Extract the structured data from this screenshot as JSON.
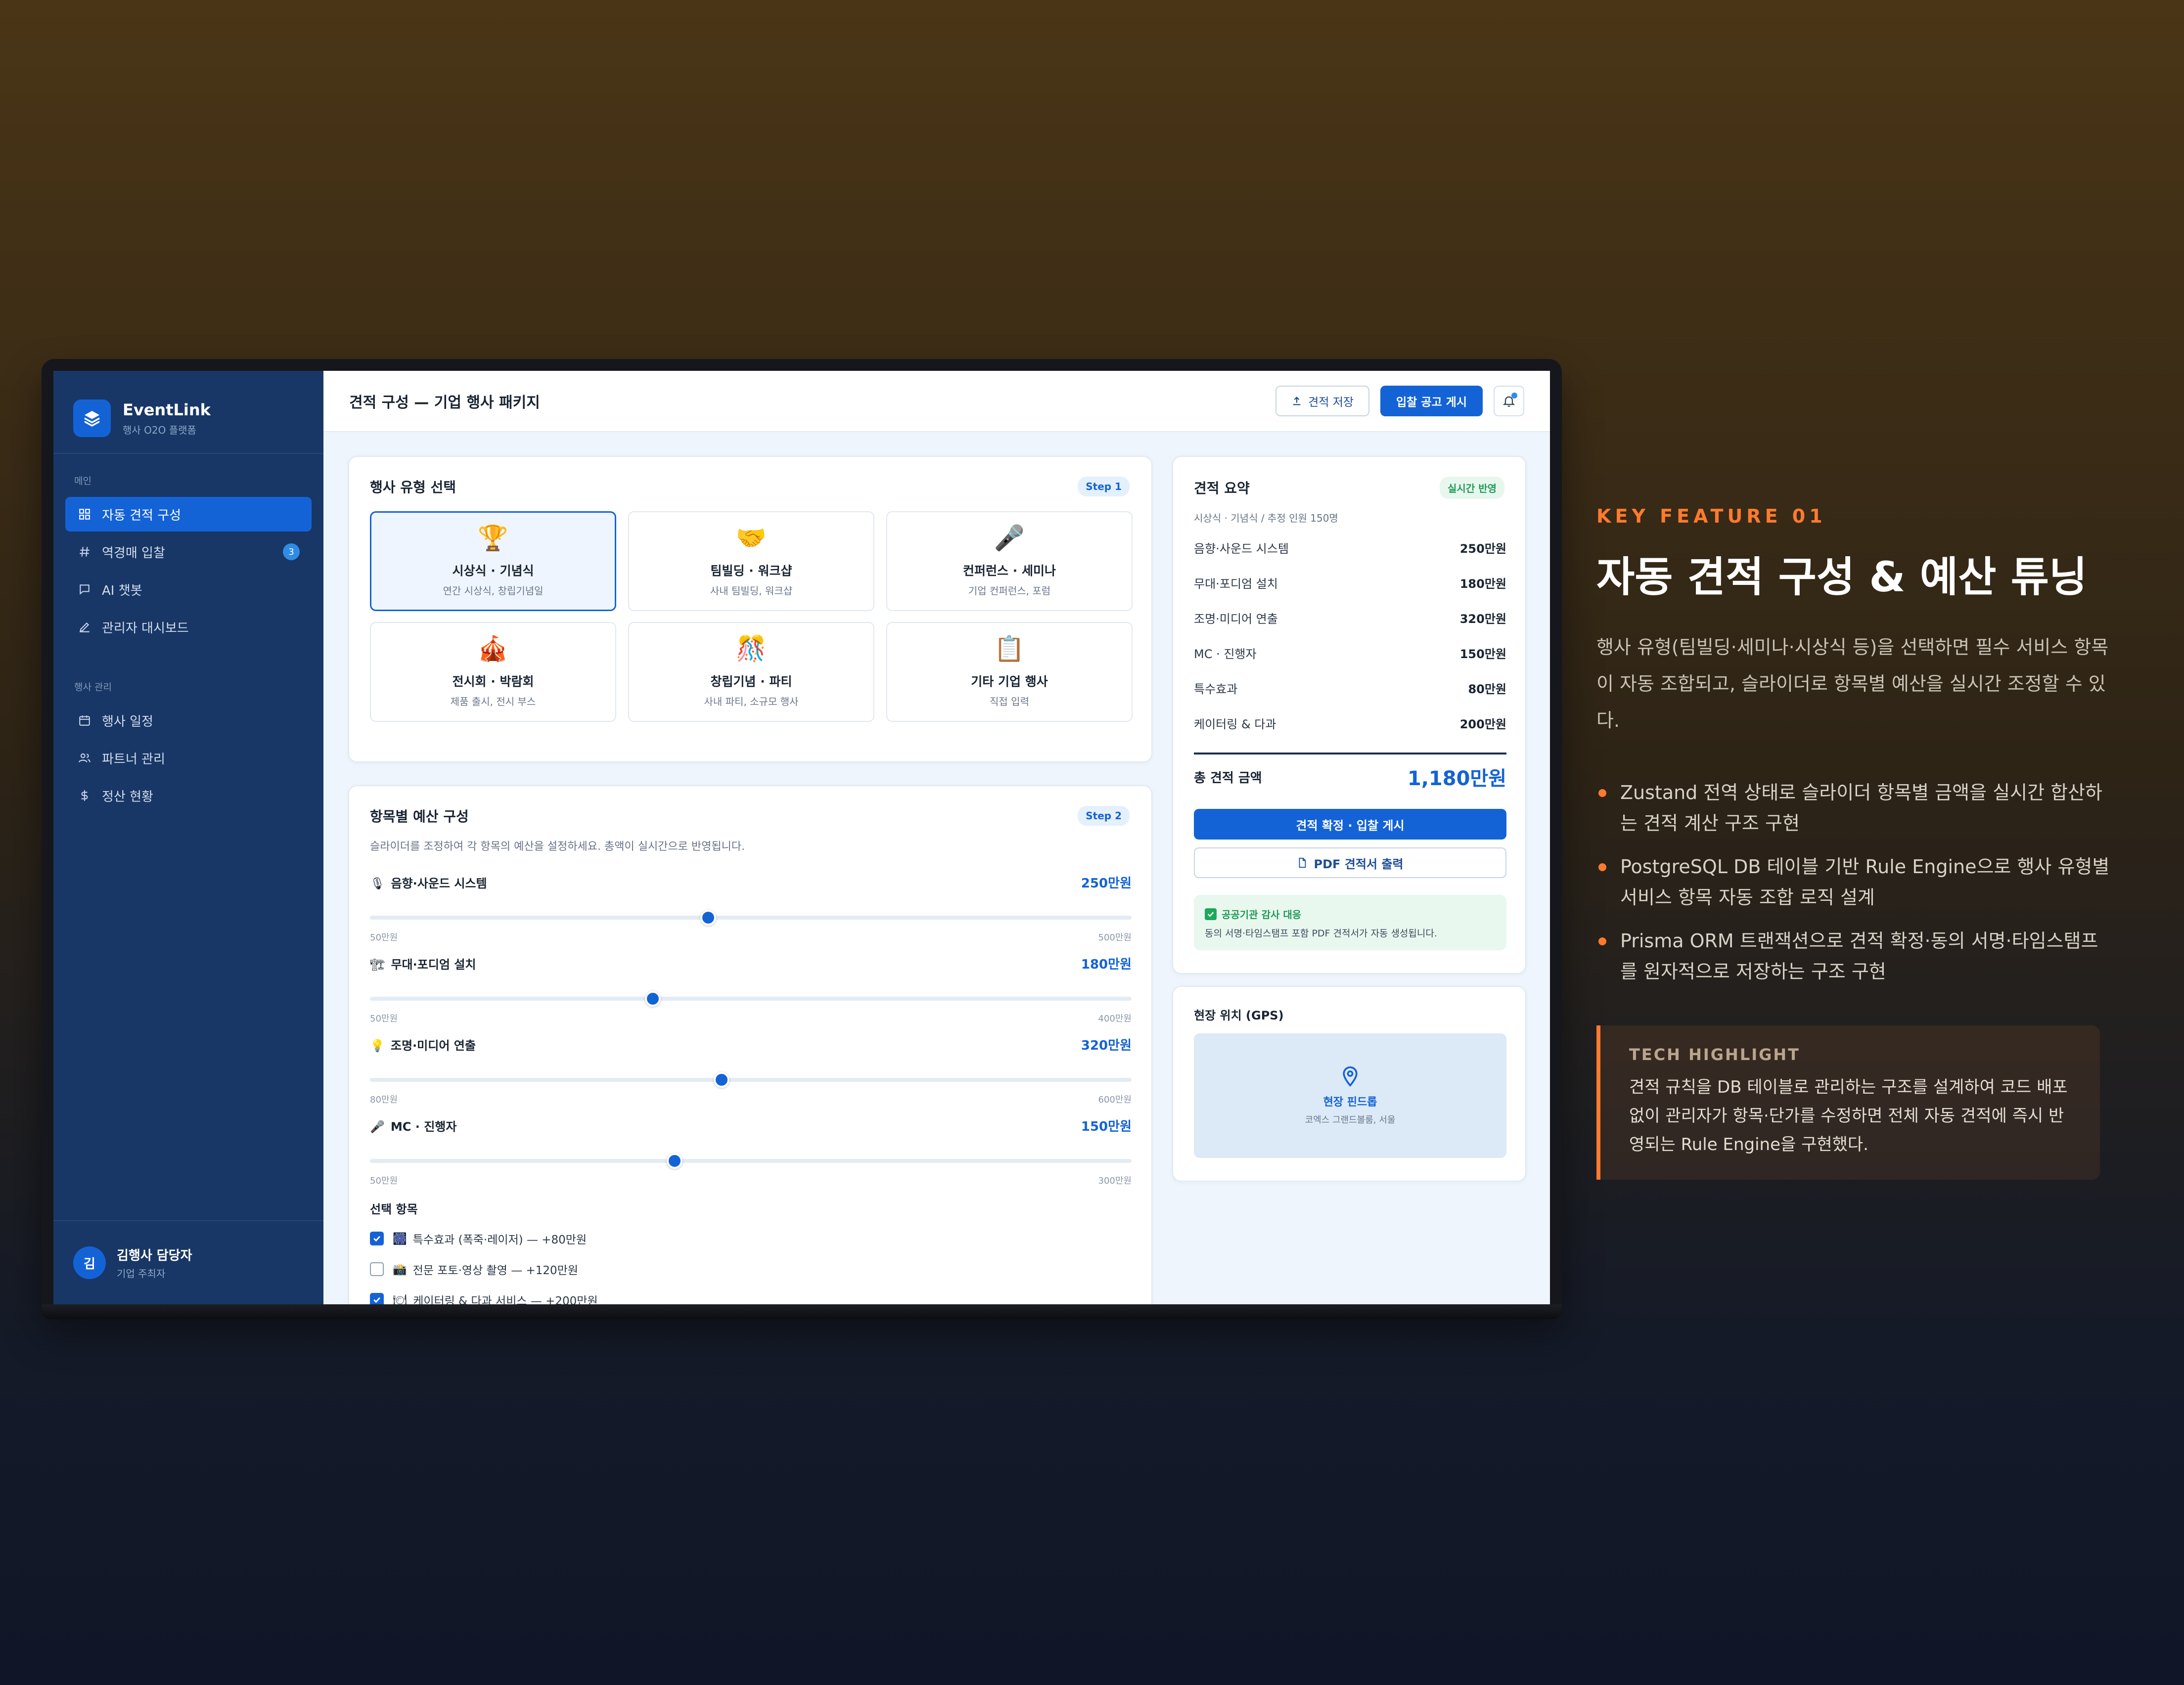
{
  "app": {
    "name": "EventLink",
    "subtitle": "행사 O2O 플랫폼"
  },
  "sidebar": {
    "section_main": "메인",
    "section_manage": "행사 관리",
    "main_items": [
      {
        "label": "자동 견적 구성",
        "icon": "grid-icon",
        "active": true
      },
      {
        "label": "역경매 입찰",
        "icon": "hashtag-icon",
        "badge": "3"
      },
      {
        "label": "AI 챗봇",
        "icon": "chat-icon"
      },
      {
        "label": "관리자 대시보드",
        "icon": "pen-icon"
      }
    ],
    "manage_items": [
      {
        "label": "행사 일정",
        "icon": "calendar-icon"
      },
      {
        "label": "파트너 관리",
        "icon": "users-icon"
      },
      {
        "label": "정산 현황",
        "icon": "dollar-icon"
      }
    ],
    "user": {
      "initial": "김",
      "name": "김행사 담당자",
      "role": "기업 주최자"
    }
  },
  "header": {
    "title": "견적 구성 — 기업 행사 패키지",
    "save_label": "견적 저장",
    "publish_label": "입찰 공고 게시"
  },
  "event_types": {
    "title": "행사 유형 선택",
    "step": "Step 1",
    "items": [
      {
        "emoji": "🏆",
        "name": "시상식 · 기념식",
        "desc": "연간 시상식, 창립기념일"
      },
      {
        "emoji": "🤝",
        "name": "팀빌딩 · 워크샵",
        "desc": "사내 팀빌딩, 워크샵"
      },
      {
        "emoji": "🎤",
        "name": "컨퍼런스 · 세미나",
        "desc": "기업 컨퍼런스, 포럼"
      },
      {
        "emoji": "🎪",
        "name": "전시회 · 박람회",
        "desc": "제품 출시, 전시 부스"
      },
      {
        "emoji": "🎊",
        "name": "창립기념 · 파티",
        "desc": "사내 파티, 소규모 행사"
      },
      {
        "emoji": "📋",
        "name": "기타 기업 행사",
        "desc": "직접 입력"
      }
    ]
  },
  "budget": {
    "title": "항목별 예산 구성",
    "step": "Step 2",
    "description": "슬라이더를 조정하여 각 항목의 예산을 설정하세요. 총액이 실시간으로 반영됩니다.",
    "sliders": [
      {
        "emoji": "🎙",
        "label": "음향·사운드 시스템",
        "value_label": "250만원",
        "min_label": "50만원",
        "max_label": "500만원",
        "min": 50,
        "max": 500,
        "value": 250
      },
      {
        "emoji": "🏗",
        "label": "무대·포디엄 설치",
        "value_label": "180만원",
        "min_label": "50만원",
        "max_label": "400만원",
        "min": 50,
        "max": 400,
        "value": 180
      },
      {
        "emoji": "💡",
        "label": "조명·미디어 연출",
        "value_label": "320만원",
        "min_label": "80만원",
        "max_label": "600만원",
        "min": 80,
        "max": 600,
        "value": 320
      },
      {
        "emoji": "🎤",
        "label": "MC · 진행자",
        "value_label": "150만원",
        "min_label": "50만원",
        "max_label": "300만원",
        "min": 50,
        "max": 300,
        "value": 150
      }
    ],
    "options_title": "선택 항목",
    "options": [
      {
        "emoji": "🎆",
        "label": "특수효과 (폭죽·레이저) — +80만원",
        "checked": true
      },
      {
        "emoji": "📸",
        "label": "전문 포토·영상 촬영 — +120만원",
        "checked": false
      },
      {
        "emoji": "🍽",
        "label": "케이터링 & 다과 서비스 — +200만원",
        "checked": true
      }
    ]
  },
  "summary": {
    "title": "견적 요약",
    "live_badge": "실시간 반영",
    "meta": "시상식 · 기념식 / 추정 인원 150명",
    "rows": [
      {
        "label": "음향·사운드 시스템",
        "amount": "250만원"
      },
      {
        "label": "무대·포디엄 설치",
        "amount": "180만원"
      },
      {
        "label": "조명·미디어 연출",
        "amount": "320만원"
      },
      {
        "label": "MC · 진행자",
        "amount": "150만원"
      },
      {
        "label": "특수효과",
        "amount": "80만원"
      },
      {
        "label": "케이터링 & 다과",
        "amount": "200만원"
      }
    ],
    "total_label": "총 견적 금액",
    "total_amount": "1,180만원",
    "confirm_label": "견적 확정 · 입찰 게시",
    "pdf_label": "PDF 견적서 출력",
    "notice_title": "공공기관 감사 대응",
    "notice_body": "동의 서명·타임스탬프 포함 PDF 견적서가 자동 생성됩니다."
  },
  "location": {
    "title": "현장 위치 (GPS)",
    "pin_label": "현장 핀드롭",
    "place": "코엑스 그랜드볼룸, 서울"
  },
  "feature": {
    "kicker": "KEY FEATURE 01",
    "headline": "자동 견적 구성 & 예산 튜닝",
    "lede": "행사 유형(팀빌딩·세미나·시상식 등)을 선택하면 필수 서비스 항목이 자동 조합되고, 슬라이더로 항목별 예산을 실시간 조정할 수 있다.",
    "bullets": [
      "Zustand 전역 상태로 슬라이더 항목별 금액을 실시간 합산하는 견적 계산 구조 구현",
      "PostgreSQL DB 테이블 기반 Rule Engine으로 행사 유형별 서비스 항목 자동 조합 로직 설계",
      "Prisma ORM 트랜잭션으로 견적 확정·동의 서명·타임스탬프를 원자적으로 저장하는 구조 구현"
    ],
    "tech_title": "TECH HIGHLIGHT",
    "tech_body": "견적 규칙을 DB 테이블로 관리하는 구조를 설계하여 코드 배포 없이 관리자가 항목·단가를 수정하면 전체 자동 견적에 즉시 반영되는 Rule Engine을 구현했다."
  },
  "colors": {
    "accent": "#1463d6",
    "sidebar": "#183766",
    "highlight": "#ff7a2e"
  }
}
